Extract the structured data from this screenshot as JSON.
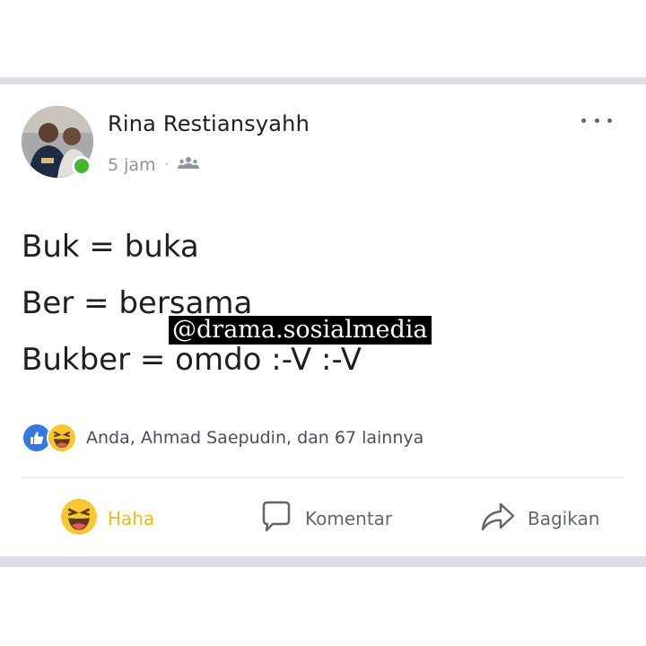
{
  "post": {
    "author_name": "Rina Restiansyahh",
    "time": "5 jam",
    "privacy_icon": "friends-icon",
    "lines": [
      "Buk = buka",
      "Ber = bersama",
      "Bukber = omdo :-V :-V"
    ],
    "watermark": "@drama.sosialmedia",
    "reactions_text": "Anda, Ahmad Saepudin, dan 67 lainnya",
    "reaction_icons": [
      "like-icon",
      "haha-icon"
    ]
  },
  "actions": {
    "haha_label": "Haha",
    "comment_label": "Komentar",
    "share_label": "Bagikan"
  },
  "colors": {
    "separator": "#dddfe6",
    "like_blue": "#3578e5",
    "haha_yellow": "#f0ba15",
    "online_green": "#42b72a",
    "secondary_text": "#8d949e"
  }
}
